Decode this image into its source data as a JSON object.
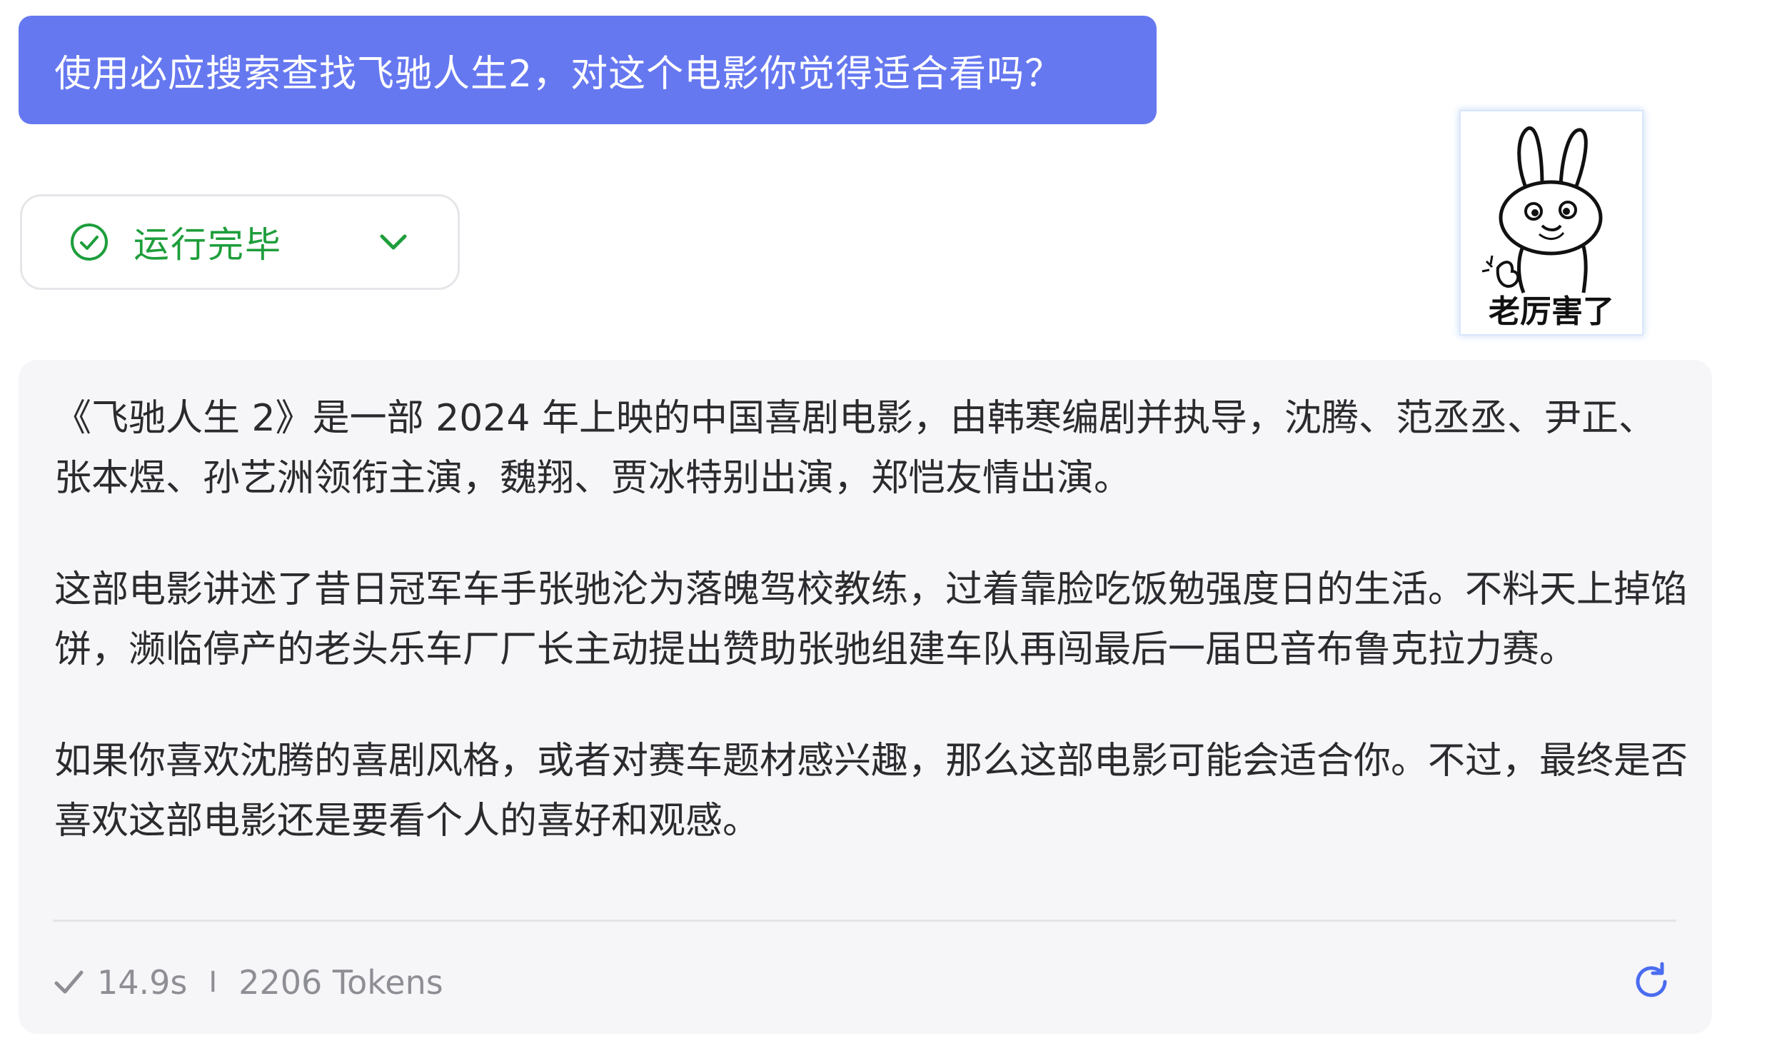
{
  "user_message": "使用必应搜索查找飞驰人生2，对这个电影你觉得适合看吗？",
  "status": {
    "label": "运行完毕",
    "icon": "check-circle-icon",
    "expand_icon": "chevron-down-icon",
    "color": "#1e9e3b"
  },
  "sticker": {
    "caption": "老厉害了",
    "icon": "rabbit-thumbs-up-sticker"
  },
  "answer": {
    "paragraphs": [
      "《飞驰人生 2》是一部 2024 年上映的中国喜剧电影，由韩寒编剧并执导，沈腾、范丞丞、尹正、张本煜、孙艺洲领衔主演，魏翔、贾冰特别出演，郑恺友情出演。",
      "这部电影讲述了昔日冠军车手张驰沦为落魄驾校教练，过着靠脸吃饭勉强度日的生活。不料天上掉馅饼，濒临停产的老头乐车厂厂长主动提出赞助张驰组建车队再闯最后一届巴音布鲁克拉力赛。",
      "如果你喜欢沈腾的喜剧风格，或者对赛车题材感兴趣，那么这部电影可能会适合你。不过，最终是否喜欢这部电影还是要看个人的喜好和观感。"
    ]
  },
  "meta": {
    "duration": "14.9s",
    "separator": "I",
    "tokens": "2206 Tokens",
    "check_icon": "check-icon",
    "refresh_icon": "refresh-icon"
  },
  "colors": {
    "user_bubble": "#6678f0",
    "accent_blue": "#4a6cf0",
    "card_bg": "#f6f6f8"
  }
}
